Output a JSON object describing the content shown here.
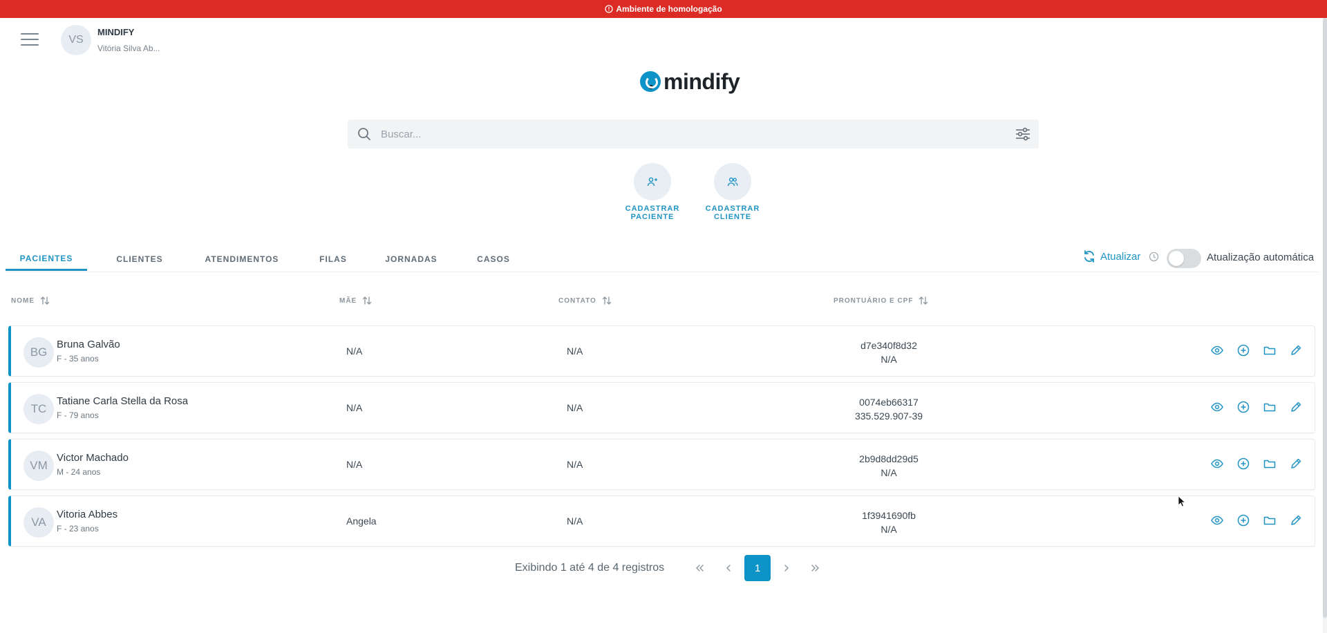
{
  "banner": {
    "text": "Ambiente de homologação",
    "icon": "alert-circle-icon",
    "color": "#dc2a24"
  },
  "user": {
    "initials": "VS",
    "org": "MINDIFY",
    "name": "Vitória Silva Ab..."
  },
  "logo": {
    "text": "mindify",
    "brand_color": "#0d93c7"
  },
  "search": {
    "placeholder": "Buscar...",
    "value": ""
  },
  "quick_actions": [
    {
      "label": "CADASTRAR PACIENTE",
      "icon": "user-plus-icon"
    },
    {
      "label": "CADASTRAR CLIENTE",
      "icon": "users-icon"
    }
  ],
  "tabs": [
    {
      "label": "PACIENTES",
      "active": true
    },
    {
      "label": "CLIENTES"
    },
    {
      "label": "ATENDIMENTOS"
    },
    {
      "label": "FILAS"
    },
    {
      "label": "JORNADAS"
    },
    {
      "label": "CASOS"
    }
  ],
  "refresh": {
    "label": "Atualizar",
    "auto_label": "Atualização automática",
    "auto_enabled": false
  },
  "table": {
    "headers": [
      "NOME",
      "MÃE",
      "CONTATO",
      "PRONTUÁRIO E CPF"
    ],
    "rows": [
      {
        "initials": "BG",
        "name": "Bruna Galvão",
        "sub": "F - 35 anos",
        "mae": "N/A",
        "contato": "N/A",
        "prontuario": "d7e340f8d32",
        "cpf": "N/A"
      },
      {
        "initials": "TC",
        "name": "Tatiane Carla Stella da Rosa",
        "sub": "F - 79 anos",
        "mae": "N/A",
        "contato": "N/A",
        "prontuario": "0074eb66317",
        "cpf": "335.529.907-39"
      },
      {
        "initials": "VM",
        "name": "Victor Machado",
        "sub": "M - 24 anos",
        "mae": "N/A",
        "contato": "N/A",
        "prontuario": "2b9d8dd29d5",
        "cpf": "N/A"
      },
      {
        "initials": "VA",
        "name": "Vitoria Abbes",
        "sub": "F - 23 anos",
        "mae": "Angela",
        "contato": "N/A",
        "prontuario": "1f3941690fb",
        "cpf": "N/A"
      }
    ],
    "row_actions": [
      "eye-icon",
      "plus-circle-icon",
      "folder-icon",
      "pencil-icon"
    ]
  },
  "pagination": {
    "info": "Exibindo 1 até 4 de 4 registros",
    "current_page": "1"
  }
}
